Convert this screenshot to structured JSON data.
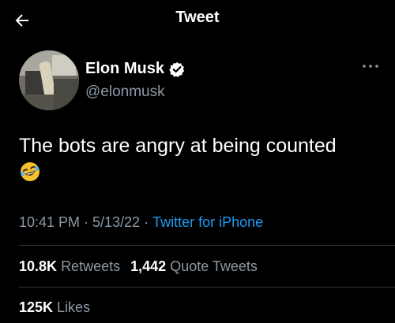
{
  "header": {
    "title": "Tweet",
    "back_icon": "arrow-left-icon"
  },
  "author": {
    "display_name": "Elon Musk",
    "handle": "@elonmusk",
    "verified_icon": "verified-badge-icon",
    "more_icon": "more-horizontal-icon"
  },
  "tweet": {
    "text": "The bots are angry at being counted",
    "emoji_icon": "rolling-on-floor-laughing-emoji"
  },
  "meta": {
    "time": "10:41 PM",
    "date": "5/13/22",
    "separator": "·",
    "source": "Twitter for iPhone"
  },
  "stats": {
    "retweets_count": "10.8K",
    "retweets_label": "Retweets",
    "quotes_count": "1,442",
    "quotes_label": "Quote Tweets",
    "likes_count": "125K",
    "likes_label": "Likes"
  },
  "colors": {
    "background": "#000000",
    "text_primary": "#ffffff",
    "text_secondary": "#8b98a5",
    "link": "#1d9bf0",
    "divider": "#2f3336",
    "emoji_yellow": "#f7c12e"
  }
}
